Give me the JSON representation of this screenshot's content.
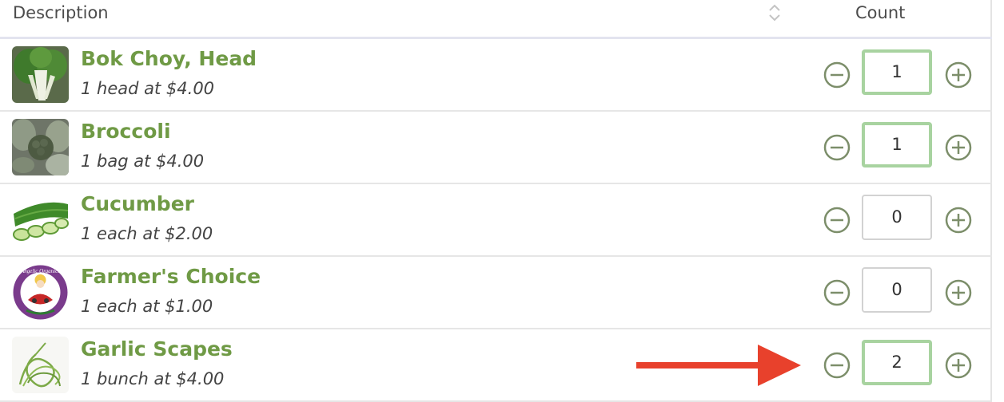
{
  "header": {
    "description_label": "Description",
    "count_label": "Count"
  },
  "items": [
    {
      "name": "Bok Choy, Head",
      "detail": "1 head at $4.00",
      "count": "1",
      "thumb_icon": "bok-choy-image"
    },
    {
      "name": "Broccoli",
      "detail": "1 bag at $4.00",
      "count": "1",
      "thumb_icon": "broccoli-image"
    },
    {
      "name": "Cucumber",
      "detail": "1 each at $2.00",
      "count": "0",
      "thumb_icon": "cucumber-image"
    },
    {
      "name": "Farmer's Choice",
      "detail": "1 each at $1.00",
      "count": "0",
      "thumb_icon": "farm-logo-image",
      "logo_text": "Angelic Organics"
    },
    {
      "name": "Garlic Scapes",
      "detail": "1 bunch at $4.00",
      "count": "2",
      "thumb_icon": "garlic-scapes-image"
    }
  ],
  "colors": {
    "accent_green": "#6f9a45",
    "active_border": "#a8d3a0",
    "arrow_red": "#e8412c"
  }
}
